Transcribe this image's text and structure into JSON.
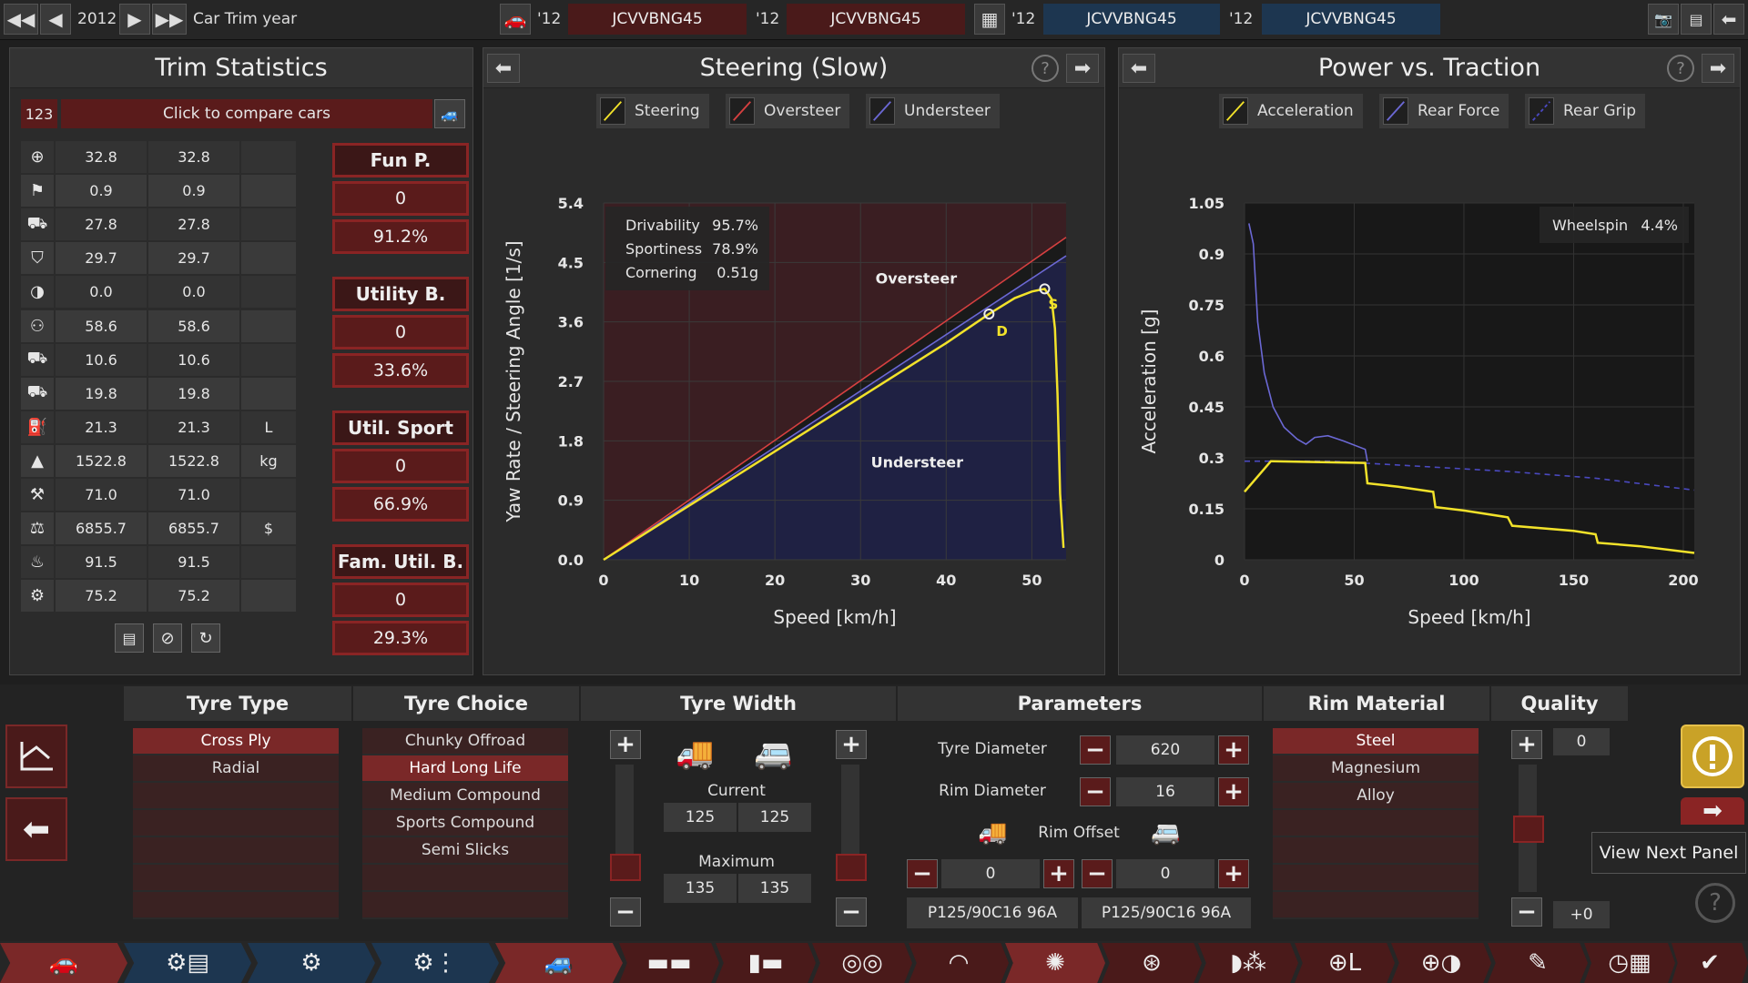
{
  "topbar": {
    "year": "2012",
    "title": "Car Trim year",
    "tabs": [
      {
        "year": "'12",
        "code": "JCVVBNG45"
      },
      {
        "year": "'12",
        "code": "JCVVBNG45"
      },
      {
        "year": "'12",
        "code": "JCVVBNG45"
      },
      {
        "year": "'12",
        "code": "JCVVBNG45"
      }
    ]
  },
  "trim": {
    "title": "Trim Statistics",
    "id_box": "123",
    "compare_label": "Click to compare cars",
    "rows": [
      {
        "icon": "steering-wheel-icon",
        "a": "32.8",
        "b": "32.8",
        "unit": ""
      },
      {
        "icon": "checkered-flag-icon",
        "a": "0.9",
        "b": "0.9",
        "unit": ""
      },
      {
        "icon": "car-seat-icon",
        "a": "27.8",
        "b": "27.8",
        "unit": ""
      },
      {
        "icon": "shield-icon",
        "a": "29.7",
        "b": "29.7",
        "unit": ""
      },
      {
        "icon": "wheel-icon",
        "a": "0.0",
        "b": "0.0",
        "unit": ""
      },
      {
        "icon": "passengers-icon",
        "a": "58.6",
        "b": "58.6",
        "unit": ""
      },
      {
        "icon": "cargo-car-icon",
        "a": "10.6",
        "b": "10.6",
        "unit": ""
      },
      {
        "icon": "road-car-icon",
        "a": "19.8",
        "b": "19.8",
        "unit": ""
      },
      {
        "icon": "fuel-icon",
        "a": "21.3",
        "b": "21.3",
        "unit": "L"
      },
      {
        "icon": "weight-icon",
        "a": "1522.8",
        "b": "1522.8",
        "unit": "kg"
      },
      {
        "icon": "emissions-icon",
        "a": "71.0",
        "b": "71.0",
        "unit": ""
      },
      {
        "icon": "money-bag-icon",
        "a": "6855.7",
        "b": "6855.7",
        "unit": "$"
      },
      {
        "icon": "service-icon",
        "a": "91.5",
        "b": "91.5",
        "unit": ""
      },
      {
        "icon": "gear-wrench-icon",
        "a": "75.2",
        "b": "75.2",
        "unit": ""
      }
    ],
    "scores": [
      {
        "title": "Fun P.",
        "value": "0",
        "pct": "91.2%"
      },
      {
        "title": "Utility B.",
        "value": "0",
        "pct": "33.6%"
      },
      {
        "title": "Util. Sport",
        "value": "0",
        "pct": "66.9%"
      },
      {
        "title": "Fam. Util. B.",
        "value": "0",
        "pct": "29.3%"
      }
    ]
  },
  "steering": {
    "title": "Steering (Slow)",
    "legend": [
      "Steering",
      "Oversteer",
      "Understeer"
    ],
    "info": [
      {
        "label": "Drivability",
        "value": "95.7%"
      },
      {
        "label": "Sportiness",
        "value": "78.9%"
      },
      {
        "label": "Cornering",
        "value": "0.51g"
      }
    ],
    "region_over": "Oversteer",
    "region_under": "Understeer",
    "marker_d": "D",
    "marker_s": "S"
  },
  "power": {
    "title": "Power vs. Traction",
    "legend": [
      "Acceleration",
      "Rear Force",
      "Rear Grip"
    ],
    "info_label": "Wheelspin",
    "info_value": "4.4%"
  },
  "chart_data": [
    {
      "type": "line",
      "title": "Steering (Slow)",
      "xlabel": "Speed [km/h]",
      "ylabel": "Yaw Rate / Steering Angle [1/s]",
      "xlim": [
        0,
        54
      ],
      "ylim": [
        0,
        5.4
      ],
      "xticks": [
        0,
        10,
        20,
        30,
        40,
        50
      ],
      "yticks": [
        "0.0",
        "0.9",
        "1.8",
        "2.7",
        "3.6",
        "4.5",
        "5.4"
      ],
      "grid": true,
      "series": [
        {
          "name": "Steering",
          "color": "#f2e22a",
          "points": [
            [
              0,
              0
            ],
            [
              10,
              0.82
            ],
            [
              20,
              1.64
            ],
            [
              30,
              2.46
            ],
            [
              40,
              3.28
            ],
            [
              45,
              3.72
            ],
            [
              48,
              3.96
            ],
            [
              50,
              4.06
            ],
            [
              51.5,
              4.1
            ],
            [
              52.3,
              3.95
            ],
            [
              52.7,
              3.5
            ],
            [
              53.0,
              2.5
            ],
            [
              53.3,
              1.0
            ],
            [
              53.7,
              0.18
            ]
          ]
        },
        {
          "name": "Oversteer",
          "color": "#d64040",
          "points": [
            [
              0,
              0
            ],
            [
              54,
              4.88
            ]
          ]
        },
        {
          "name": "Understeer",
          "color": "#6b68d4",
          "points": [
            [
              0,
              0
            ],
            [
              54,
              4.6
            ]
          ]
        }
      ]
    },
    {
      "type": "line",
      "title": "Power vs. Traction",
      "xlabel": "Speed [km/h]",
      "ylabel": "Acceleration [g]",
      "xlim": [
        0,
        205
      ],
      "ylim": [
        0,
        1.05
      ],
      "xticks": [
        0,
        50,
        100,
        150,
        200
      ],
      "yticks": [
        "0",
        "0.15",
        "0.3",
        "0.45",
        "0.6",
        "0.75",
        "0.9",
        "1.05"
      ],
      "grid": true,
      "series": [
        {
          "name": "Acceleration",
          "color": "#f2e22a",
          "points": [
            [
              0,
              0.2
            ],
            [
              12,
              0.29
            ],
            [
              55,
              0.285
            ],
            [
              56,
              0.225
            ],
            [
              70,
              0.215
            ],
            [
              86,
              0.2
            ],
            [
              87,
              0.155
            ],
            [
              100,
              0.145
            ],
            [
              120,
              0.125
            ],
            [
              122,
              0.1
            ],
            [
              150,
              0.085
            ],
            [
              160,
              0.075
            ],
            [
              161,
              0.05
            ],
            [
              180,
              0.04
            ],
            [
              205,
              0.02
            ]
          ]
        },
        {
          "name": "Rear Force",
          "color": "#6b68d4",
          "points": [
            [
              2,
              0.99
            ],
            [
              4,
              0.93
            ],
            [
              6,
              0.7
            ],
            [
              9,
              0.55
            ],
            [
              13,
              0.45
            ],
            [
              18,
              0.39
            ],
            [
              24,
              0.355
            ],
            [
              28,
              0.34
            ],
            [
              32,
              0.36
            ],
            [
              38,
              0.365
            ],
            [
              45,
              0.35
            ],
            [
              55,
              0.325
            ],
            [
              56,
              0.29
            ]
          ]
        },
        {
          "name": "Rear Grip",
          "color": "#4a49c0",
          "points": [
            [
              0,
              0.29
            ],
            [
              40,
              0.29
            ],
            [
              80,
              0.275
            ],
            [
              120,
              0.26
            ],
            [
              160,
              0.24
            ],
            [
              205,
              0.205
            ]
          ]
        }
      ]
    }
  ],
  "bottom": {
    "headers": [
      "Tyre Type",
      "Tyre Choice",
      "Tyre Width",
      "Parameters",
      "Rim Material",
      "Quality"
    ],
    "tyre_type": [
      {
        "label": "Cross Ply",
        "selected": true
      },
      {
        "label": "Radial",
        "selected": false
      },
      {
        "label": "",
        "selected": false
      },
      {
        "label": "",
        "selected": false
      },
      {
        "label": "",
        "selected": false
      },
      {
        "label": "",
        "selected": false
      },
      {
        "label": "",
        "selected": false
      }
    ],
    "tyre_choice": [
      {
        "label": "Chunky Offroad",
        "selected": false
      },
      {
        "label": "Hard Long Life",
        "selected": true
      },
      {
        "label": "Medium Compound",
        "selected": false
      },
      {
        "label": "Sports Compound",
        "selected": false
      },
      {
        "label": "Semi Slicks",
        "selected": false
      },
      {
        "label": "",
        "selected": false
      },
      {
        "label": "",
        "selected": false
      }
    ],
    "width": {
      "current_label": "Current",
      "current_front": "125",
      "current_rear": "125",
      "maximum_label": "Maximum",
      "max_front": "135",
      "max_rear": "135"
    },
    "params": {
      "tyre_diameter_label": "Tyre Diameter",
      "tyre_diameter": "620",
      "rim_diameter_label": "Rim Diameter",
      "rim_diameter": "16",
      "rim_offset_label": "Rim Offset",
      "offset_front": "0",
      "offset_rear": "0",
      "code_front": "P125/90C16 96A",
      "code_rear": "P125/90C16  96A"
    },
    "rim_material": [
      {
        "label": "Steel",
        "selected": true
      },
      {
        "label": "Magnesium",
        "selected": false
      },
      {
        "label": "Alloy",
        "selected": false
      },
      {
        "label": "",
        "selected": false
      },
      {
        "label": "",
        "selected": false
      },
      {
        "label": "",
        "selected": false
      },
      {
        "label": "",
        "selected": false
      }
    ],
    "quality_top": "0",
    "quality_bottom": "+0",
    "tooltip": "View Next Panel"
  },
  "colors": {
    "accent_red": "#7a2828",
    "steering_yellow": "#f2e22a",
    "understeer_blue": "#6b68d4",
    "warning_yellow": "#c9a227"
  }
}
